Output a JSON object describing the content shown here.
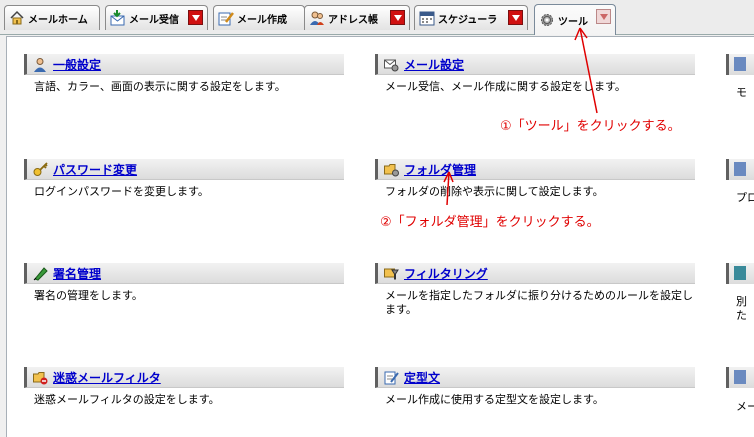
{
  "tabs": [
    {
      "label": "メールホーム",
      "icon": "home-icon"
    },
    {
      "label": "メール受信",
      "icon": "receive-mail-icon"
    },
    {
      "label": "メール作成",
      "icon": "compose-mail-icon"
    },
    {
      "label": "アドレス帳",
      "icon": "address-book-icon"
    },
    {
      "label": "スケジューラ",
      "icon": "calendar-icon"
    },
    {
      "label": "ツール",
      "icon": "gear-icon",
      "active": true
    }
  ],
  "items": [
    {
      "title": "一般設定",
      "desc": "言語、カラー、画面の表示に関する設定をします。",
      "icon": "user-icon"
    },
    {
      "title": "メール設定",
      "desc": "メール受信、メール作成に関する設定をします。",
      "icon": "mail-settings-icon"
    },
    {
      "title": "パスワード変更",
      "desc": "ログインパスワードを変更します。",
      "icon": "key-icon"
    },
    {
      "title": "フォルダ管理",
      "desc": "フォルダの削除や表示に関して設定します。",
      "icon": "folder-settings-icon"
    },
    {
      "title": "署名管理",
      "desc": "署名の管理をします。",
      "icon": "signature-pen-icon"
    },
    {
      "title": "フィルタリング",
      "desc": "メールを指定したフォルダに振り分けるためのルールを設定します。",
      "icon": "filter-icon"
    },
    {
      "title": "迷惑メールフィルタ",
      "desc": "迷惑メールフィルタの設定をします。",
      "icon": "spam-folder-icon"
    },
    {
      "title": "定型文",
      "desc": "メール作成に使用する定型文を設定します。",
      "icon": "template-note-icon"
    }
  ],
  "right_edge": {
    "desc_fragments": [
      "モ",
      "プロ",
      "別",
      "た",
      "メー"
    ]
  },
  "annotations": {
    "step1": "①「ツール」をクリックする。",
    "step2": "②「フォルダ管理」をクリックする。",
    "color": "#e00000"
  }
}
